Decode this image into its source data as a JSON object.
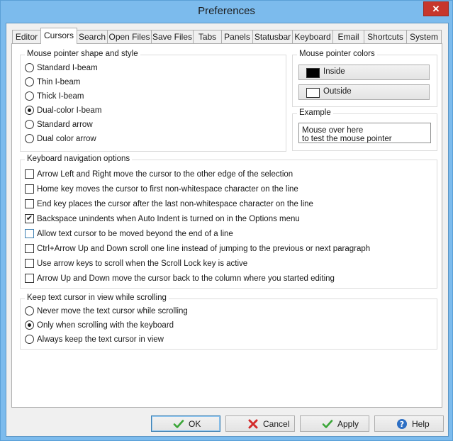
{
  "window": {
    "title": "Preferences",
    "close": "✕"
  },
  "tabs": [
    "Editor",
    "Cursors",
    "Search",
    "Open Files",
    "Save Files",
    "Tabs",
    "Panels",
    "Statusbar",
    "Keyboard",
    "Email",
    "Shortcuts",
    "System"
  ],
  "active_tab": "Cursors",
  "pointer_shape": {
    "title": "Mouse pointer shape and style",
    "options": [
      "Standard I-beam",
      "Thin I-beam",
      "Thick I-beam",
      "Dual-color I-beam",
      "Standard arrow",
      "Dual color arrow"
    ],
    "selected": "Dual-color I-beam"
  },
  "pointer_colors": {
    "title": "Mouse pointer colors",
    "inside_label": "Inside",
    "outside_label": "Outside",
    "inside_color": "#000000",
    "outside_color": "#ffffff"
  },
  "example": {
    "title": "Example",
    "line1": "Mouse over here",
    "line2": "to test the mouse pointer"
  },
  "keyboard_nav": {
    "title": "Keyboard navigation options",
    "items": [
      {
        "label": "Arrow Left and Right move the cursor to the other edge of the selection",
        "checked": false
      },
      {
        "label": "Home key moves the cursor to first non-whitespace character on the line",
        "checked": false
      },
      {
        "label": "End key places the cursor after the last non-whitespace character on the line",
        "checked": false
      },
      {
        "label": "Backspace unindents when Auto Indent is turned on in the Options menu",
        "checked": true
      },
      {
        "label": "Allow text cursor to be moved beyond the end of a line",
        "checked": false
      },
      {
        "label": "Ctrl+Arrow Up and Down scroll one line instead of jumping to the previous or next paragraph",
        "checked": false
      },
      {
        "label": "Use arrow keys to scroll when the Scroll Lock key is active",
        "checked": false
      },
      {
        "label": "Arrow Up and Down move the cursor back to the column where you started editing",
        "checked": false
      }
    ]
  },
  "keep_in_view": {
    "title": "Keep text cursor in view while scrolling",
    "options": [
      "Never move the text cursor while scrolling",
      "Only when scrolling with the keyboard",
      "Always keep the text cursor in view"
    ],
    "selected": "Only when scrolling with the keyboard"
  },
  "buttons": {
    "ok": "OK",
    "cancel": "Cancel",
    "apply": "Apply",
    "help": "Help"
  },
  "colors": {
    "check_green": "#3aa637",
    "cancel_red": "#d32a2a",
    "help_blue": "#2d6fc4"
  }
}
